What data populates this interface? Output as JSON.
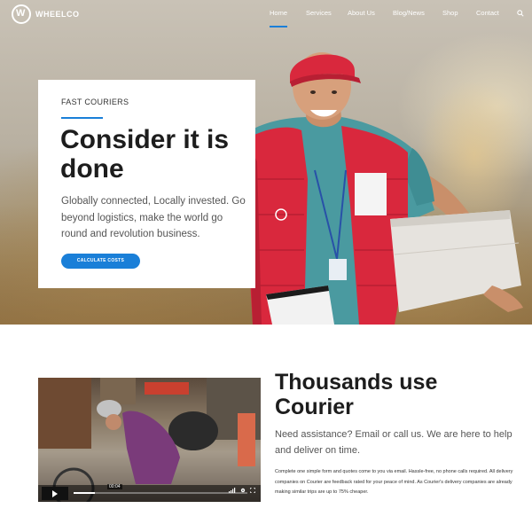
{
  "brand": {
    "name": "WHEELCO"
  },
  "nav": {
    "items": [
      "Home",
      "Services",
      "About Us",
      "Blog/News",
      "Shop",
      "Contact"
    ],
    "active": "Home",
    "search_icon": "search-icon"
  },
  "hero": {
    "kicker": "FAST COURIERS",
    "title": "Consider it is done",
    "description": "Globally connected, Locally invested. Go beyond logistics, make the world go round and revolution business.",
    "cta": "CALCULATE COSTS"
  },
  "video": {
    "time": "00:04",
    "progress": 0.12,
    "icons": [
      "play-icon",
      "volume-icon",
      "settings-icon",
      "fullscreen-icon"
    ]
  },
  "section": {
    "title": "Thousands use Courier",
    "lead": "Need assistance? Email or call us. We are here to help and deliver on time.",
    "body": "Complete one simple form and quotes come to you via email. Hassle-free, no phone calls required. All delivery companies on Courier are feedback rated for your peace of mind. As Courier's delivery companies are already making similar trips are up to 75% cheaper."
  },
  "colors": {
    "accent": "#1a7fd8",
    "vest": "#d9283d"
  }
}
